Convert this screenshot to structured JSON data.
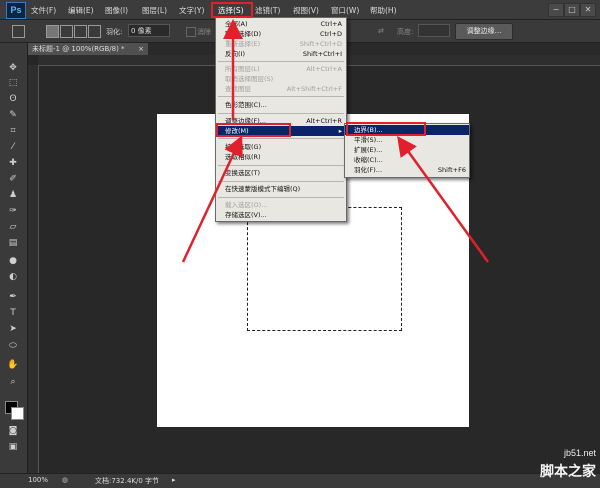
{
  "app": {
    "logo": "Ps"
  },
  "menubar": {
    "items": [
      "文件(F)",
      "编辑(E)",
      "图像(I)",
      "图层(L)",
      "文字(Y)",
      "选择(S)",
      "滤镜(T)",
      "视图(V)",
      "窗口(W)",
      "帮助(H)"
    ],
    "window_controls": {
      "minimize": "−",
      "restore": "□",
      "close": "✕"
    }
  },
  "options": {
    "feather_label": "羽化:",
    "feather_value": "0 像素",
    "antialias_label": "消除",
    "height_label": "高度:",
    "refine_edge_button": "调整边缘..."
  },
  "document": {
    "tab_title": "未标题-1 @ 100%(RGB/8) *",
    "tab_close": "×"
  },
  "select_menu": {
    "items": [
      {
        "label": "全部(A)",
        "shortcut": "Ctrl+A",
        "enabled": true
      },
      {
        "label": "取消选择(D)",
        "shortcut": "Ctrl+D",
        "enabled": true
      },
      {
        "label": "重新选择(E)",
        "shortcut": "Shift+Ctrl+D",
        "enabled": false
      },
      {
        "label": "反向(I)",
        "shortcut": "Shift+Ctrl+I",
        "enabled": true
      },
      {
        "label": "所有图层(L)",
        "shortcut": "Alt+Ctrl+A",
        "enabled": false
      },
      {
        "label": "取消选择图层(S)",
        "shortcut": "",
        "enabled": false
      },
      {
        "label": "查找图层",
        "shortcut": "Alt+Shift+Ctrl+F",
        "enabled": false
      },
      {
        "label": "色彩范围(C)...",
        "shortcut": "",
        "enabled": true
      },
      {
        "label": "调整边缘(F)...",
        "shortcut": "Alt+Ctrl+R",
        "enabled": true
      },
      {
        "label": "修改(M)",
        "shortcut": "▸",
        "enabled": true,
        "highlighted": true
      },
      {
        "label": "扩大选取(G)",
        "shortcut": "",
        "enabled": true
      },
      {
        "label": "选取相似(R)",
        "shortcut": "",
        "enabled": true
      },
      {
        "label": "变换选区(T)",
        "shortcut": "",
        "enabled": true
      },
      {
        "label": "在快速蒙版模式下编辑(Q)",
        "shortcut": "",
        "enabled": true
      },
      {
        "label": "载入选区(O)...",
        "shortcut": "",
        "enabled": false
      },
      {
        "label": "存储选区(V)...",
        "shortcut": "",
        "enabled": true
      }
    ]
  },
  "modify_submenu": {
    "items": [
      {
        "label": "边界(B)...",
        "shortcut": "",
        "highlighted": true
      },
      {
        "label": "平滑(S)...",
        "shortcut": ""
      },
      {
        "label": "扩展(E)...",
        "shortcut": ""
      },
      {
        "label": "收缩(C)...",
        "shortcut": ""
      },
      {
        "label": "羽化(F)...",
        "shortcut": "Shift+F6"
      }
    ]
  },
  "status": {
    "zoom": "100%",
    "doc_size": "文档:732.4K/0 字节"
  },
  "watermark": {
    "url": "jb51.net",
    "name": "脚本之家"
  },
  "colors": {
    "highlight": "#0a246a",
    "annotation_red": "#e0202a",
    "menu_bg": "#e9e7e2"
  }
}
